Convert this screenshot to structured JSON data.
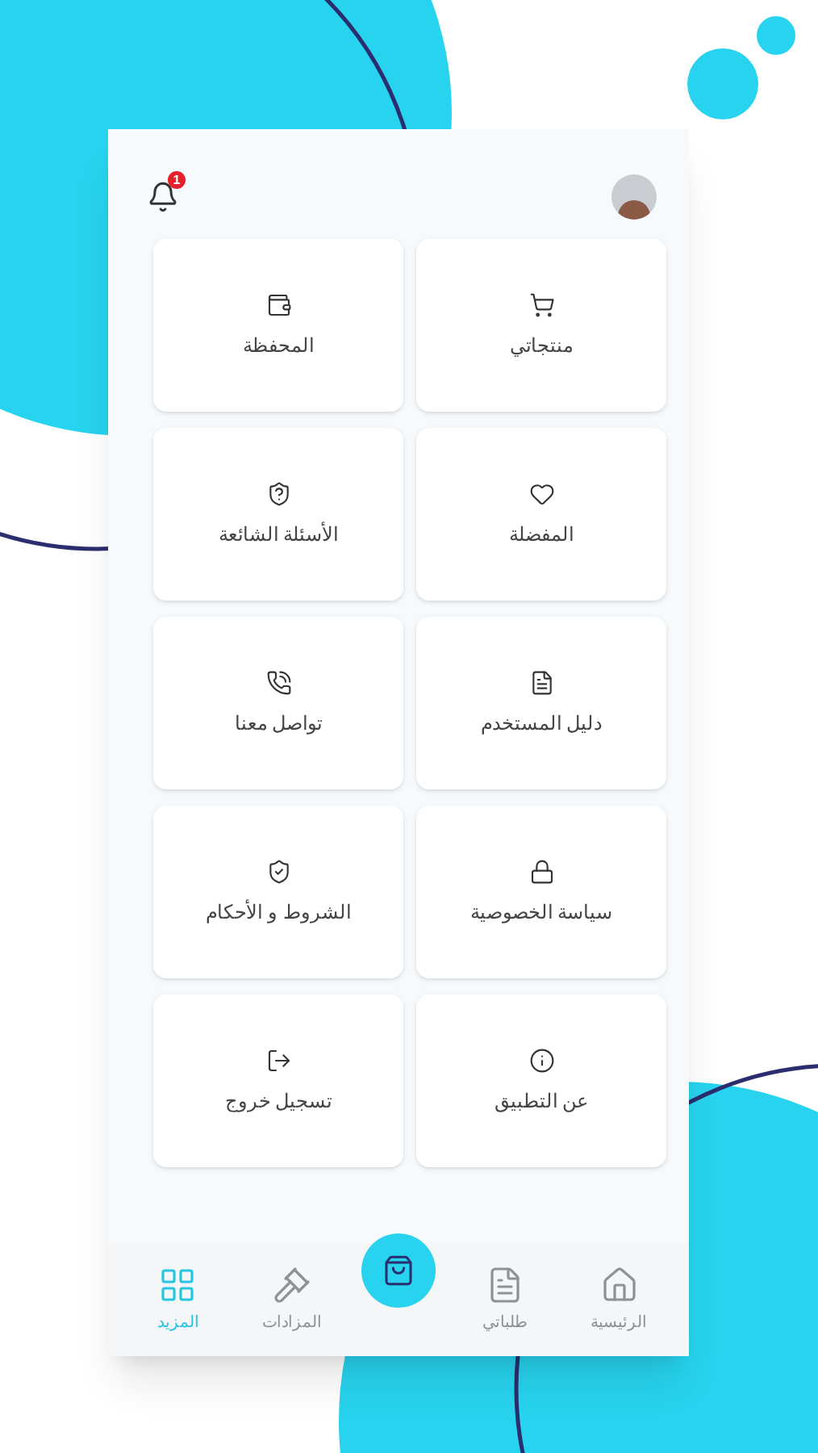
{
  "header": {
    "notification_count": "1"
  },
  "menu": [
    {
      "label": "منتجاتي",
      "kind": "cart"
    },
    {
      "label": "المحفظة",
      "kind": "wallet"
    },
    {
      "label": "المفضلة",
      "kind": "heart"
    },
    {
      "label": "الأسئلة الشائعة",
      "kind": "faq"
    },
    {
      "label": "دليل المستخدم",
      "kind": "guide"
    },
    {
      "label": "تواصل معنا",
      "kind": "phone"
    },
    {
      "label": "سياسة الخصوصية",
      "kind": "privacy"
    },
    {
      "label": "الشروط و الأحكام",
      "kind": "terms"
    },
    {
      "label": "عن التطبيق",
      "kind": "info"
    },
    {
      "label": "تسجيل خروج",
      "kind": "logout"
    }
  ],
  "bottom_nav": [
    {
      "label": "الرئيسية",
      "kind": "home",
      "selected": false
    },
    {
      "label": "طلباتي",
      "kind": "orders",
      "selected": false
    },
    {
      "kind": "center"
    },
    {
      "label": "المزادات",
      "kind": "auctions",
      "selected": false
    },
    {
      "label": "المزيد",
      "kind": "more",
      "selected": true
    }
  ]
}
